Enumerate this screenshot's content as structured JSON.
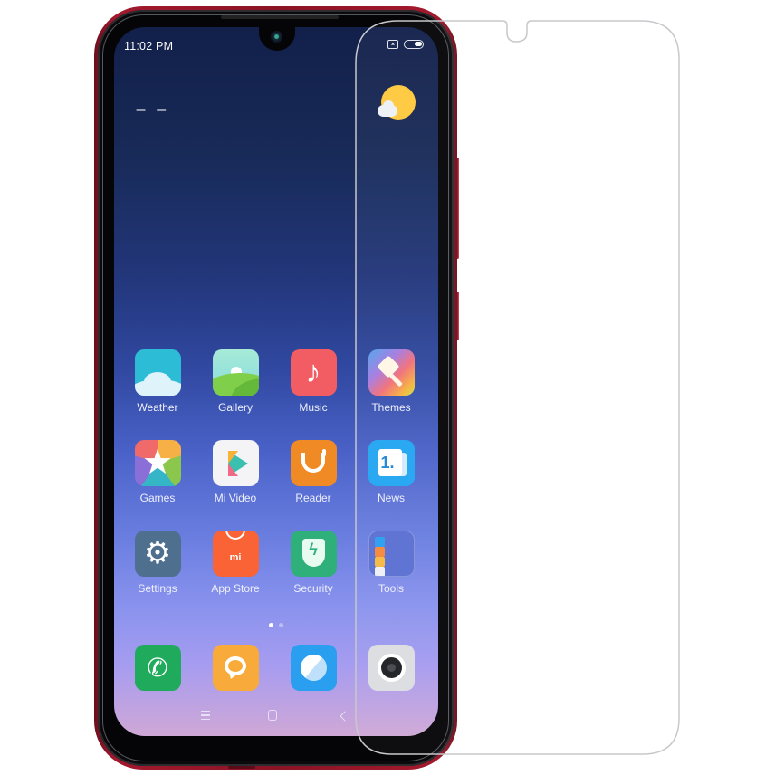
{
  "product": {
    "name": "Phone with tempered glass screen protector",
    "phone_color": "#8a1424",
    "protector_outline_color": "#c8c8cc"
  },
  "status_bar": {
    "time": "11:02 PM",
    "icons": [
      "no-sim-icon",
      "battery-icon"
    ]
  },
  "widgets": {
    "clock_placeholder": "– –",
    "weather_icon": "partly-sunny-icon"
  },
  "apps": [
    [
      {
        "label": "Weather",
        "icon": "weather-icon",
        "color": "#2cbcd6"
      },
      {
        "label": "Gallery",
        "icon": "gallery-icon",
        "color": "#7fcf4a"
      },
      {
        "label": "Music",
        "icon": "music-icon",
        "color": "#f25d63",
        "glyph": "♪"
      },
      {
        "label": "Themes",
        "icon": "themes-icon",
        "color": "#a57be0"
      }
    ],
    [
      {
        "label": "Games",
        "icon": "games-icon",
        "color": "#f6b046",
        "glyph": "★"
      },
      {
        "label": "Mi Video",
        "icon": "mi-video-icon",
        "color": "#f4f4f6"
      },
      {
        "label": "Reader",
        "icon": "reader-icon",
        "color": "#f08a24"
      },
      {
        "label": "News",
        "icon": "news-icon",
        "color": "#23a5f2",
        "glyph": "1."
      }
    ],
    [
      {
        "label": "Settings",
        "icon": "settings-icon",
        "color": "#4f6f8e",
        "glyph": "⚙"
      },
      {
        "label": "App Store",
        "icon": "app-store-icon",
        "color": "#f96335",
        "glyph": "mi"
      },
      {
        "label": "Security",
        "icon": "security-icon",
        "color": "#2fb07a",
        "glyph": "ϟ"
      },
      {
        "label": "Tools",
        "icon": "tools-folder-icon",
        "color": "#5a6fd2",
        "folder_colors": [
          "#2a9ff0",
          "#f5883a",
          "#f8b940",
          "#eef0f6",
          "#21a5d8",
          "#f5a43a",
          "#21a5c8",
          "#f26a3a",
          "#3a3d48"
        ]
      }
    ]
  ],
  "page_indicator": {
    "total": 2,
    "active": 1,
    "active_color": "#ffffff",
    "inactive_color": "#b9bff0"
  },
  "dock": [
    {
      "icon": "phone-icon",
      "color": "#1faa5c",
      "glyph": "✆"
    },
    {
      "icon": "messages-icon",
      "color": "#f8ab3a"
    },
    {
      "icon": "browser-icon",
      "color": "#2a9ff0"
    },
    {
      "icon": "camera-icon",
      "color": "#dcdde0"
    }
  ],
  "nav_bar": [
    "menu-icon",
    "home-icon",
    "back-icon"
  ]
}
